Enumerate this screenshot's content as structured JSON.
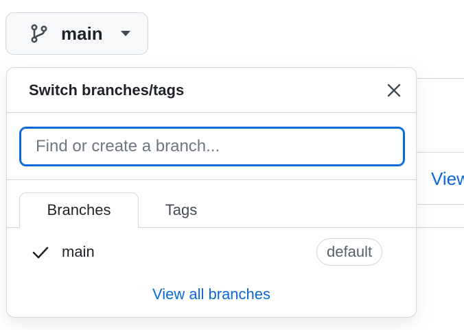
{
  "branch_button": {
    "label": "main",
    "icon": "git-branch-icon",
    "caret_icon": "triangle-down-icon"
  },
  "dropdown": {
    "title": "Switch branches/tags",
    "close_icon": "x-icon",
    "search": {
      "placeholder": "Find or create a branch...",
      "value": ""
    },
    "tabs": [
      {
        "label": "Branches",
        "selected": true
      },
      {
        "label": "Tags",
        "selected": false
      }
    ],
    "branches": [
      {
        "name": "main",
        "checked": true,
        "badge": "default"
      }
    ],
    "view_all_label": "View all branches"
  },
  "background": {
    "link_fragment": "View"
  },
  "colors": {
    "accent": "#0969da",
    "border": "#d0d7de",
    "button_bg": "#f6f8fa",
    "text": "#1f2328",
    "muted": "#57606a"
  }
}
